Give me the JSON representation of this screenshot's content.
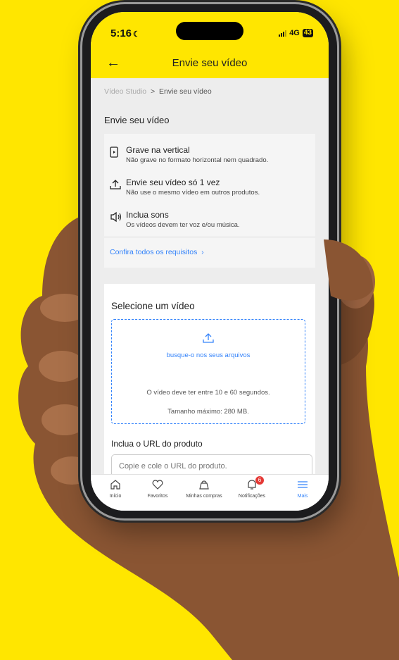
{
  "status": {
    "time": "5:16",
    "network": "4G",
    "battery": "43"
  },
  "appbar": {
    "title": "Envie seu vídeo"
  },
  "breadcrumb": {
    "parent": "Vídeo Studio",
    "separator": ">",
    "current": "Envie seu vídeo"
  },
  "section": {
    "title": "Envie seu vídeo"
  },
  "requirements": [
    {
      "icon": "vertical-phone-icon",
      "title": "Grave na vertical",
      "desc": "Não grave no formato horizontal nem quadrado."
    },
    {
      "icon": "upload-icon",
      "title": "Envie seu vídeo só 1 vez",
      "desc": "Não use o mesmo vídeo em outros produtos."
    },
    {
      "icon": "speaker-icon",
      "title": "Inclua sons",
      "desc": "Os vídeos devem ter voz e/ou música."
    }
  ],
  "requirements_link": "Confira todos os requisitos",
  "upload": {
    "title": "Selecione um vídeo",
    "browse_label": "busque-o nos seus arquivos",
    "hint_duration": "O vídeo deve ter entre 10 e 60 segundos.",
    "hint_size": "Tamanho máximo: 280 MB."
  },
  "url": {
    "title": "Inclua o URL do produto",
    "placeholder": "Copie e cole o URL do produto."
  },
  "nav": [
    {
      "label": "Início",
      "icon": "home-icon"
    },
    {
      "label": "Favoritos",
      "icon": "heart-icon"
    },
    {
      "label": "Minhas compras",
      "icon": "bag-icon"
    },
    {
      "label": "Notificações",
      "icon": "bell-icon",
      "badge": "6"
    },
    {
      "label": "Mais",
      "icon": "menu-icon",
      "active": true
    }
  ],
  "colors": {
    "brand_yellow": "#FFE600",
    "accent_blue": "#3483fa",
    "badge_red": "#e53935"
  }
}
